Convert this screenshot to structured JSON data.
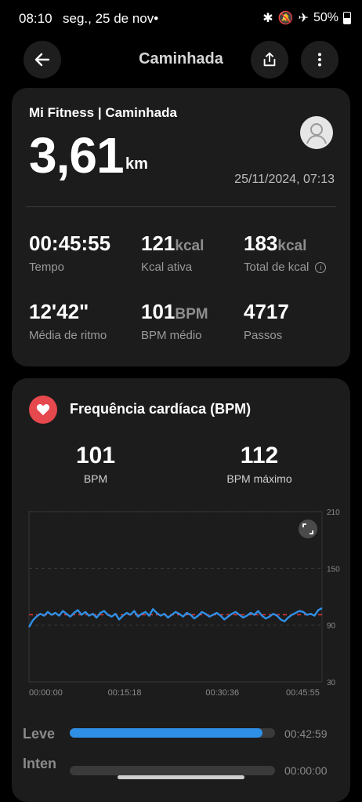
{
  "status_bar": {
    "time": "08:10",
    "date": "seg., 25 de nov•",
    "battery": "50%"
  },
  "header": {
    "title": "Caminhada"
  },
  "summary": {
    "brand": "Mi Fitness | Caminhada",
    "distance": "3,61",
    "distance_unit": "km",
    "datetime": "25/11/2024, 07:13",
    "stats": [
      {
        "value": "00:45:55",
        "unit": "",
        "label": "Tempo"
      },
      {
        "value": "121",
        "unit": "kcal",
        "label": "Kcal ativa"
      },
      {
        "value": "183",
        "unit": "kcal",
        "label": "Total de kcal"
      },
      {
        "value": "12'42\"",
        "unit": "",
        "label": "Média de ritmo"
      },
      {
        "value": "101",
        "unit": "BPM",
        "label": "BPM médio"
      },
      {
        "value": "4717",
        "unit": "",
        "label": "Passos"
      }
    ]
  },
  "heart_rate": {
    "title": "Frequência cardíaca (BPM)",
    "avg_value": "101",
    "avg_label": "BPM",
    "max_value": "112",
    "max_label": "BPM máximo"
  },
  "chart_data": {
    "type": "line",
    "y_ticks": [
      "210",
      "150",
      "90",
      "30"
    ],
    "ylim": [
      30,
      210
    ],
    "x_ticks": [
      "00:00:00",
      "00:15:18",
      "00:30:36",
      "00:45:55"
    ],
    "average_line": 101,
    "colors": {
      "line": "#2f8fe6",
      "average": "#e53935"
    },
    "series": [
      {
        "values": [
          88,
          95,
          99,
          102,
          100,
          104,
          101,
          103,
          100,
          105,
          102,
          99,
          103,
          106,
          101,
          104,
          100,
          102,
          98,
          103,
          105,
          101,
          99,
          102,
          96,
          100,
          103,
          101,
          105,
          99,
          102,
          104,
          100,
          107,
          103,
          100,
          102,
          98,
          101,
          104,
          102,
          99,
          103,
          101,
          97,
          100,
          104,
          102,
          99,
          101,
          103,
          100,
          96,
          99,
          102,
          104,
          101,
          98,
          100,
          103,
          101,
          105,
          100,
          97,
          99,
          102,
          100,
          96,
          94,
          98,
          101,
          103,
          105,
          104,
          101,
          102,
          100,
          106,
          108
        ]
      }
    ]
  },
  "zones": [
    {
      "label": "Leve",
      "time": "00:42:59",
      "fraction": 0.94
    },
    {
      "label": "Inten",
      "time": "00:00:00",
      "fraction": 0
    }
  ]
}
